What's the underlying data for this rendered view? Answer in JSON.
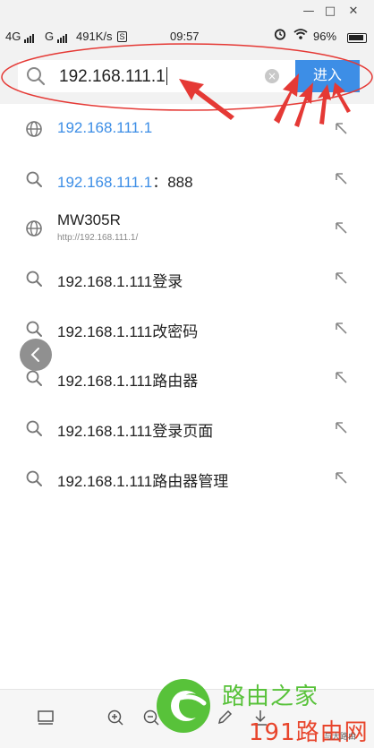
{
  "window": {
    "minimize_glyph": "—",
    "maximize_glyph": "□",
    "close_glyph": "✕"
  },
  "status_bar": {
    "network1": "4G",
    "network2": "G",
    "speed": "491K/s",
    "speed_badge": "S",
    "time": "09:57",
    "battery": "96%"
  },
  "search": {
    "value": "192.168.111.1",
    "go_label": "进入",
    "icons": {
      "search": "search-icon",
      "clear": "clear-icon"
    }
  },
  "suggestions": [
    {
      "icon": "globe-icon",
      "highlight": "192.168.111.1",
      "rest": "",
      "type": "url"
    },
    {
      "icon": "search-icon",
      "highlight": "192.168.111.1",
      "rest": "：888",
      "type": "search"
    },
    {
      "icon": "globe-icon",
      "title": "MW305R",
      "url": "http://192.168.111.1/",
      "type": "bookmark"
    },
    {
      "icon": "search-icon",
      "text": "192.168.1.111登录",
      "type": "search"
    },
    {
      "icon": "search-icon",
      "text": "192.168.1.111改密码",
      "type": "search"
    },
    {
      "icon": "search-icon",
      "text": "192.168.1.111路由器",
      "type": "search"
    },
    {
      "icon": "search-icon",
      "text": "192.168.1.111登录页面",
      "type": "search"
    },
    {
      "icon": "search-icon",
      "text": "192.168.1.111路由器管理",
      "type": "search"
    }
  ],
  "watermark": {
    "title": "路由之家",
    "subtitle": "191路由网",
    "small": "与大路由"
  },
  "colors": {
    "accent": "#3d8ee6",
    "annotation": "#e53935",
    "watermark_green": "#58c23a",
    "watermark_red": "#e8452c"
  }
}
